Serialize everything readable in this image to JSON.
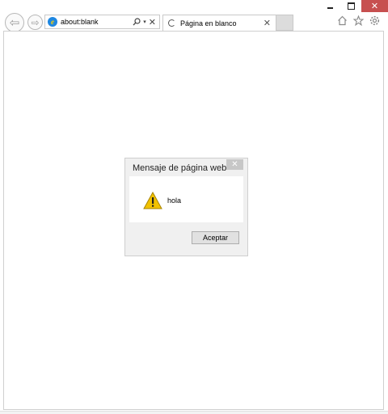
{
  "browser": {
    "address_url": "about:blank",
    "tab_label": "Página en blanco",
    "icons": {
      "back": "back-arrow-icon",
      "forward": "forward-arrow-icon",
      "search": "search-icon",
      "dropdown": "chevron-down-icon",
      "stop": "close-icon",
      "home": "home-icon",
      "favorites": "star-icon",
      "settings": "gear-icon"
    }
  },
  "dialog": {
    "title": "Mensaje de página web",
    "message": "hola",
    "ok_label": "Aceptar",
    "icon": "warning-icon"
  },
  "colors": {
    "close_button": "#c75050",
    "ie_blue": "#1e87e1"
  }
}
